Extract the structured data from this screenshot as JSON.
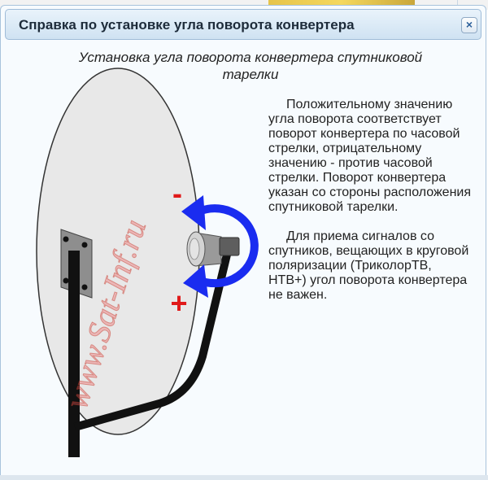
{
  "dialog": {
    "title": "Справка по установке угла поворота конвертера",
    "close_label": "×"
  },
  "content": {
    "heading_line1": "Установка угла поворота конвертера спутниковой",
    "heading_line2": "тарелки",
    "paragraph1": "Положительному значению угла поворота соответствует поворот конвертера по часовой стрелки, отрицательному значению - против часовой стрелки. Поворот конвертера указан со стороны расположения спутниковой тарелки.",
    "paragraph2": "Для приема сигналов со спутников, вещающих в круговой поляризации (ТриколорТВ, НТВ+) угол поворота конвертера не важен."
  },
  "illustration": {
    "minus_label": "-",
    "plus_label": "+",
    "watermark": "www.Sat-Inf.ru",
    "colors": {
      "arrow": "#1a2cf0",
      "sign": "#e01a1a",
      "dish_fill": "#e8e8e8",
      "dish_stroke": "#333333",
      "mount": "#222222",
      "watermark": "#f05a5a"
    },
    "icons": [
      "rotation-arrow-icon",
      "converter-icon",
      "bracket-icon"
    ]
  }
}
